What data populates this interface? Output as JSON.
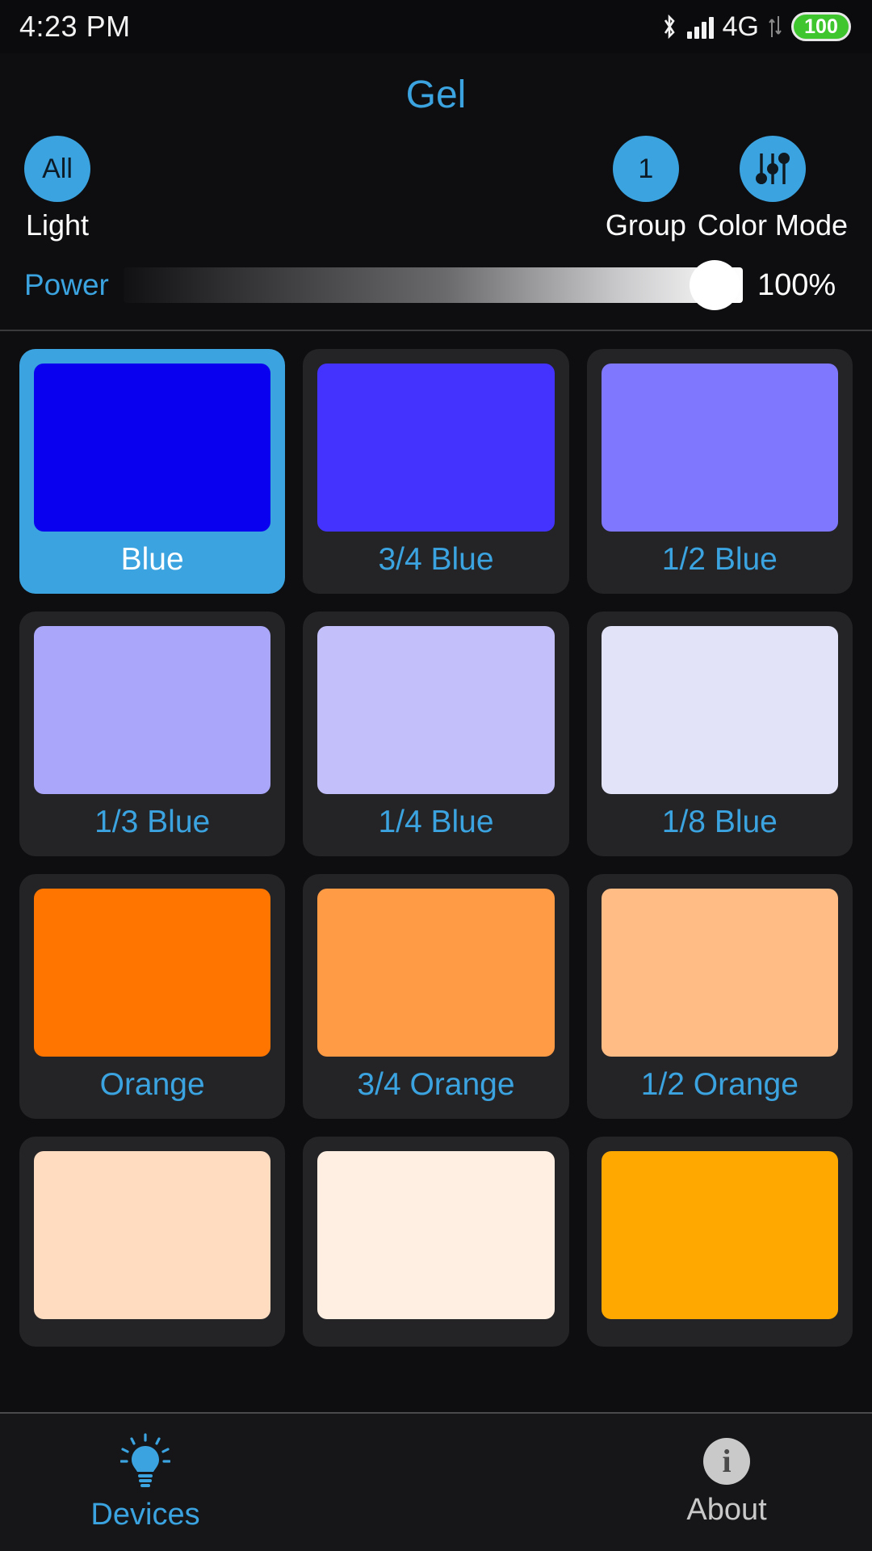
{
  "statusbar": {
    "time": "4:23 PM",
    "bluetooth_icon": "bluetooth-icon",
    "signal_icon": "signal-bars-icon",
    "network": "4G",
    "data_arrows_icon": "data-transfer-arrows-icon",
    "battery": "100"
  },
  "header": {
    "title": "Gel",
    "light_button": {
      "badge": "All",
      "label": "Light"
    },
    "group_button": {
      "badge": "1",
      "label": "Group"
    },
    "color_mode_button": {
      "icon": "sliders-icon",
      "label": "Color Mode"
    }
  },
  "power": {
    "label": "Power",
    "value": "100%",
    "percent": 100
  },
  "gels": [
    {
      "name": "Blue",
      "color": "#0A00F0",
      "selected": true
    },
    {
      "name": "3/4 Blue",
      "color": "#4433FF",
      "selected": false
    },
    {
      "name": "1/2 Blue",
      "color": "#8077FF",
      "selected": false
    },
    {
      "name": "1/3 Blue",
      "color": "#AAA6FA",
      "selected": false
    },
    {
      "name": "1/4 Blue",
      "color": "#C2BFFA",
      "selected": false
    },
    {
      "name": "1/8 Blue",
      "color": "#E2E2F8",
      "selected": false
    },
    {
      "name": "Orange",
      "color": "#FF7500",
      "selected": false
    },
    {
      "name": "3/4 Orange",
      "color": "#FF9A45",
      "selected": false
    },
    {
      "name": "1/2 Orange",
      "color": "#FFBC85",
      "selected": false
    },
    {
      "name": "",
      "color": "#FFDCC0",
      "selected": false
    },
    {
      "name": "",
      "color": "#FFEFE2",
      "selected": false
    },
    {
      "name": "",
      "color": "#FFA800",
      "selected": false
    }
  ],
  "bottomnav": {
    "devices": {
      "label": "Devices",
      "icon": "lightbulb-icon",
      "active": true
    },
    "about": {
      "label": "About",
      "icon": "info-icon",
      "active": false
    }
  },
  "colors": {
    "accent": "#3BA3DF",
    "background": "#0e0e10",
    "card": "#242426",
    "battery_green": "#3fc52e"
  }
}
